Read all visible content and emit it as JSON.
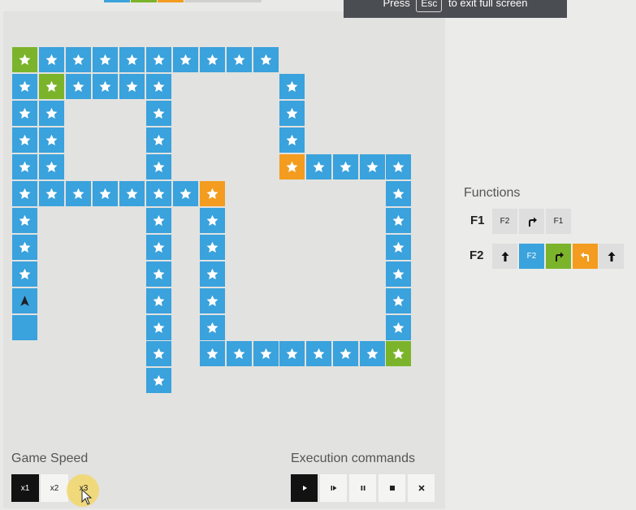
{
  "banner": {
    "press": "Press",
    "key": "Esc",
    "rest": "to exit full screen"
  },
  "board": {
    "star_color": "#ffffff",
    "tile_colors": {
      "blue": "#3aa2dc",
      "green": "#7bb42a",
      "orange": "#f39c1f"
    },
    "player": {
      "icon": "arrow-up-icon",
      "facing": "up"
    }
  },
  "game_speed": {
    "label": "Game Speed",
    "options": [
      "x1",
      "x2",
      "x3"
    ],
    "selected": "x1"
  },
  "execution": {
    "label": "Execution commands",
    "commands": [
      "play-icon",
      "step-icon",
      "pause-icon",
      "stop-icon",
      "close-icon"
    ]
  },
  "functions": {
    "title": "Functions",
    "list": [
      {
        "name": "F1",
        "slots": [
          {
            "type": "call",
            "text": "F2",
            "color": "gray"
          },
          {
            "type": "icon",
            "icon": "turn-right-icon",
            "color": "gray"
          },
          {
            "type": "call",
            "text": "F1",
            "color": "gray"
          }
        ]
      },
      {
        "name": "F2",
        "slots": [
          {
            "type": "icon",
            "icon": "arrow-up-icon",
            "color": "gray"
          },
          {
            "type": "call",
            "text": "F2",
            "color": "blue"
          },
          {
            "type": "icon",
            "icon": "turn-right-icon",
            "color": "green"
          },
          {
            "type": "icon",
            "icon": "turn-left-icon",
            "color": "orange"
          },
          {
            "type": "icon",
            "icon": "arrow-up-icon",
            "color": "gray"
          }
        ]
      }
    ]
  }
}
